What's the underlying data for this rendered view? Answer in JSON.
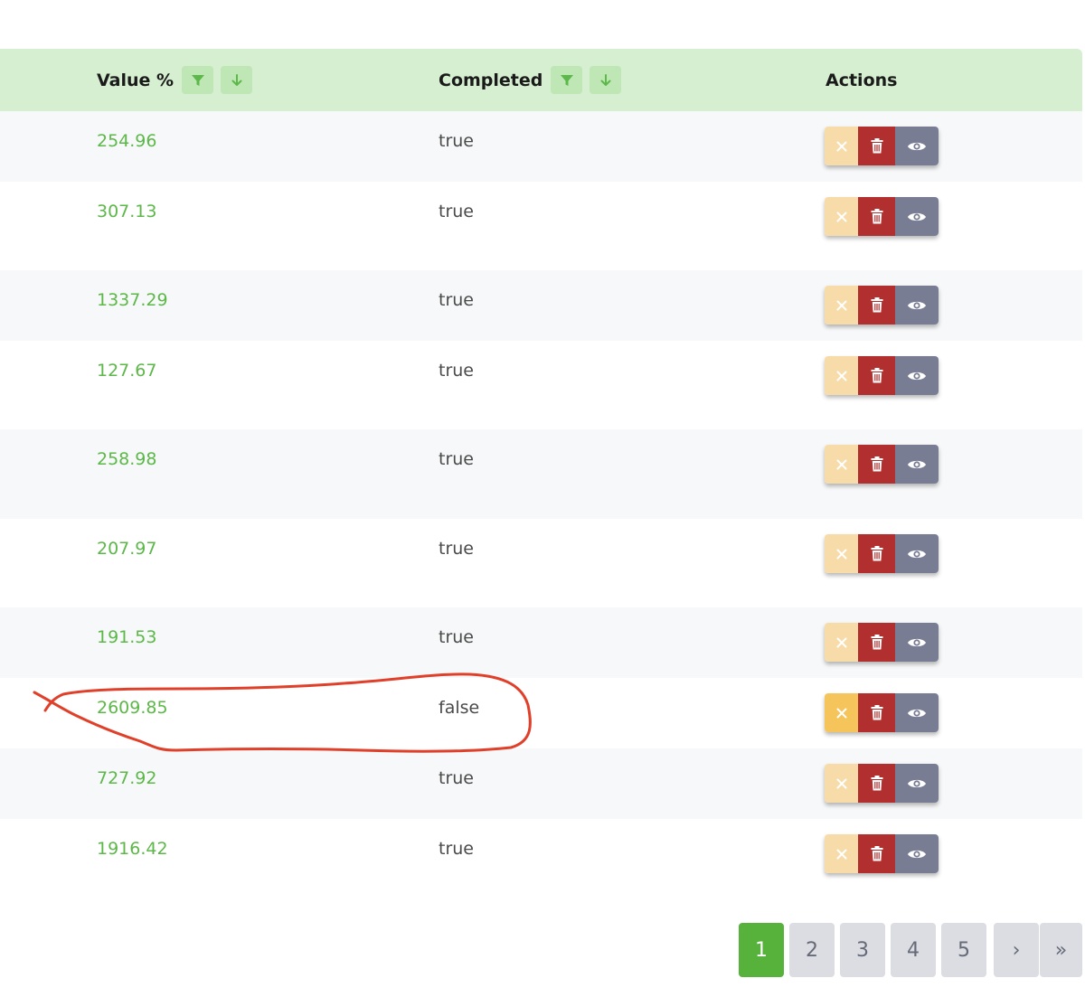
{
  "table": {
    "headers": {
      "value": "Value %",
      "completed": "Completed",
      "actions": "Actions"
    },
    "rows": [
      {
        "value": "254.96",
        "completed": "true"
      },
      {
        "value": "307.13",
        "completed": "true"
      },
      {
        "value": "1337.29",
        "completed": "true"
      },
      {
        "value": "127.67",
        "completed": "true"
      },
      {
        "value": "258.98",
        "completed": "true"
      },
      {
        "value": "207.97",
        "completed": "true"
      },
      {
        "value": "191.53",
        "completed": "true"
      },
      {
        "value": "2609.85",
        "completed": "false"
      },
      {
        "value": "727.92",
        "completed": "true"
      },
      {
        "value": "1916.42",
        "completed": "true"
      }
    ]
  },
  "pagination": {
    "pages": [
      "1",
      "2",
      "3",
      "4",
      "5"
    ],
    "next": "›",
    "last": "»",
    "current": "1"
  },
  "icons": {
    "filter": "filter-icon",
    "sort": "arrow-down-icon",
    "cancel": "close-icon",
    "delete": "trash-icon",
    "view": "eye-icon"
  },
  "colors": {
    "header_bg": "#d5efd0",
    "value_text": "#5cb848",
    "cancel_btn": "#f7dcaa",
    "cancel_btn_active": "#f5c55c",
    "delete_btn": "#b1302f",
    "view_btn": "#797d93",
    "page_active": "#56b23a",
    "annotation": "#e0402a"
  }
}
